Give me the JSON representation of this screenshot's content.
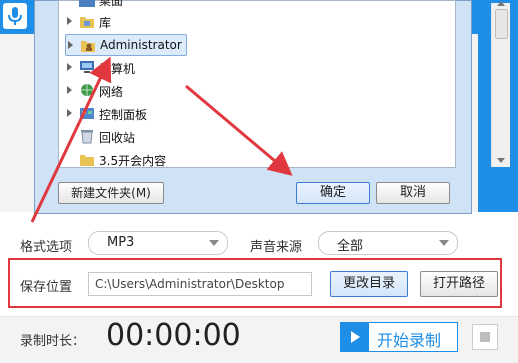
{
  "tree": {
    "items": [
      {
        "label": "桌面",
        "icon": "desktop-icon"
      },
      {
        "label": "库",
        "icon": "library-folder-icon"
      },
      {
        "label": "Administrator",
        "icon": "user-folder-icon"
      },
      {
        "label": "计算机",
        "icon": "computer-icon"
      },
      {
        "label": "网络",
        "icon": "network-icon"
      },
      {
        "label": "控制面板",
        "icon": "control-panel-icon"
      },
      {
        "label": "回收站",
        "icon": "recycle-bin-icon"
      },
      {
        "label": "3.5开会内容",
        "icon": "folder-icon"
      }
    ]
  },
  "dialog": {
    "new_folder": "新建文件夹(M)",
    "ok": "确定",
    "cancel": "取消"
  },
  "settings": {
    "format_label": "格式选项",
    "format_value": "MP3",
    "source_label": "声音来源",
    "source_value": "全部",
    "save_label": "保存位置",
    "save_path": "C:\\Users\\Administrator\\Desktop",
    "change_dir": "更改目录",
    "open_path": "打开路径"
  },
  "footer": {
    "duration_label": "录制时长：",
    "timer": "00:00:00",
    "start": "开始录制"
  },
  "colors": {
    "accent": "#1e8ee6",
    "highlight": "#e0383e"
  }
}
